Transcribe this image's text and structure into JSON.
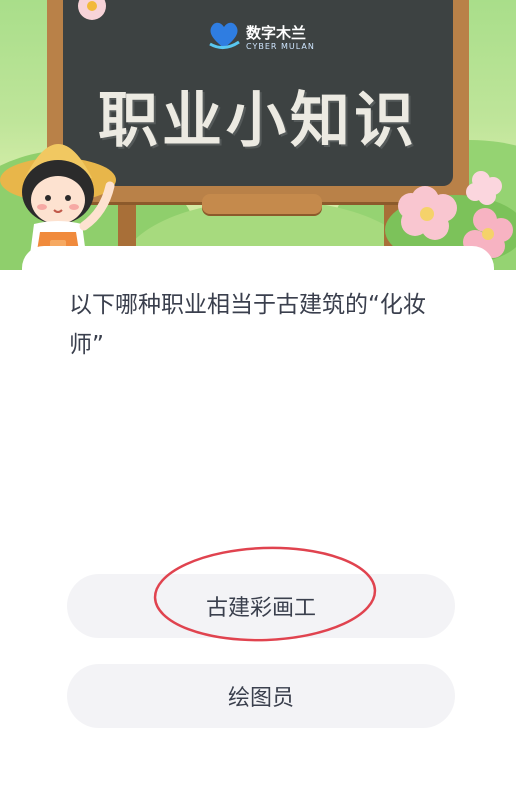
{
  "banner": {
    "logo_cn": "数字木兰",
    "logo_en": "CYBER MULAN",
    "title": "职业小知识"
  },
  "quiz": {
    "question": "以下哪种职业相当于古建筑的“化妆师”",
    "options": [
      {
        "label": "古建彩画工",
        "highlighted": true
      },
      {
        "label": "绘图员",
        "highlighted": false
      }
    ]
  },
  "colors": {
    "annotation_circle": "#e0434f",
    "option_bg": "#f3f3f6",
    "text": "#3a3f4d",
    "chalkboard": "#3d4242"
  }
}
